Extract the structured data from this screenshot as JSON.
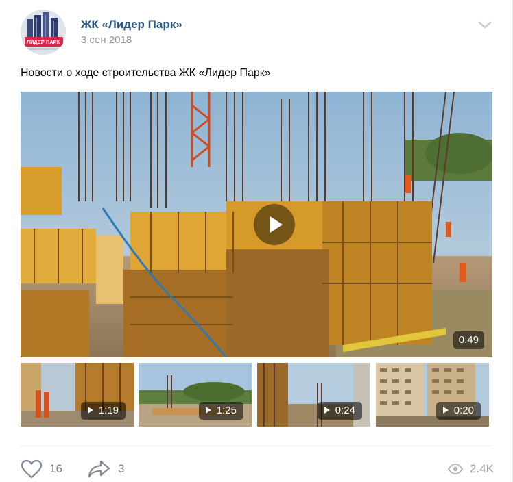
{
  "post": {
    "author": "ЖК «Лидер Парк»",
    "date": "3 сен 2018",
    "text": "Новости о ходе строительства ЖК «Лидер Парк»",
    "avatar_logo_text": "ЛИДЕР ПАРК"
  },
  "main_video": {
    "duration": "0:49"
  },
  "thumbnails": [
    {
      "duration": "1:19"
    },
    {
      "duration": "1:25"
    },
    {
      "duration": "0:24"
    },
    {
      "duration": "0:20"
    }
  ],
  "footer": {
    "likes": "16",
    "shares": "3",
    "views": "2.4K"
  },
  "icons": {
    "menu": "chevron-down-icon",
    "play": "play-icon",
    "like": "heart-icon",
    "share": "share-arrow-icon",
    "views": "eye-icon"
  },
  "colors": {
    "author_link": "#2a5885",
    "meta_gray": "#939393",
    "icon_gray": "#828282",
    "divider": "#e7e8ec",
    "avatar_badge": "#d6294b"
  }
}
